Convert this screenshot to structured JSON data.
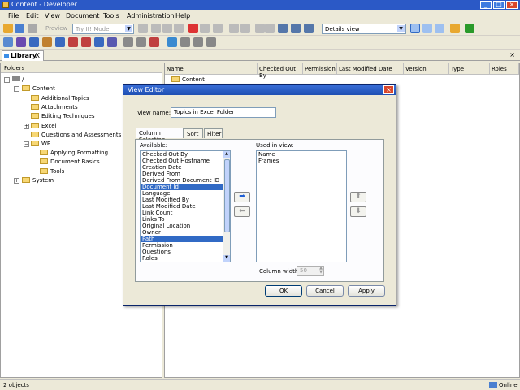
{
  "window": {
    "title": "Content - Developer"
  },
  "menu": [
    "File",
    "Edit",
    "View",
    "Document",
    "Tools",
    "Administration",
    "Help"
  ],
  "toolbar": {
    "preview_label": "Preview",
    "mode_value": "Try It! Mode",
    "view_value": "Details view"
  },
  "library_tab": {
    "label": "Library",
    "close": "X"
  },
  "folders": {
    "header": "Folders",
    "root": "/",
    "items": [
      {
        "label": "Content",
        "level": 1
      },
      {
        "label": "Additional Topics",
        "level": 2
      },
      {
        "label": "Attachments",
        "level": 2
      },
      {
        "label": "Editing Techniques",
        "level": 2
      },
      {
        "label": "Excel",
        "level": 2
      },
      {
        "label": "Questions and Assessments",
        "level": 2
      },
      {
        "label": "WP",
        "level": 2
      },
      {
        "label": "Applying Formatting",
        "level": 3
      },
      {
        "label": "Document Basics",
        "level": 3
      },
      {
        "label": "Tools",
        "level": 3
      },
      {
        "label": "System",
        "level": 1
      }
    ]
  },
  "details": {
    "columns": [
      "Name",
      "Checked Out By",
      "Permission",
      "Last Modified Date",
      "Version",
      "Type",
      "Roles"
    ],
    "rows": [
      "Content"
    ]
  },
  "dialog": {
    "title": "View Editor",
    "view_name_label": "View name:",
    "view_name_value": "Topics in Excel Folder",
    "tabs": [
      "Column Selection",
      "Sort",
      "Filter"
    ],
    "available_label": "Available:",
    "used_label": "Used in view:",
    "available": [
      "Checked Out By",
      "Checked Out Hostname",
      "Creation Date",
      "Derived From",
      "Derived From Document ID",
      "Document Id",
      "Language",
      "Last Modified By",
      "Last Modified Date",
      "Link Count",
      "Links To",
      "Original Location",
      "Owner",
      "Path",
      "Permission",
      "Questions",
      "Roles"
    ],
    "selected_available": [
      "Document Id",
      "Path"
    ],
    "used": [
      "Name",
      "Frames"
    ],
    "column_width_label": "Column width:",
    "column_width_value": "50",
    "ok": "OK",
    "cancel": "Cancel",
    "apply": "Apply"
  },
  "status": {
    "objects": "2 objects",
    "online": "Online"
  }
}
